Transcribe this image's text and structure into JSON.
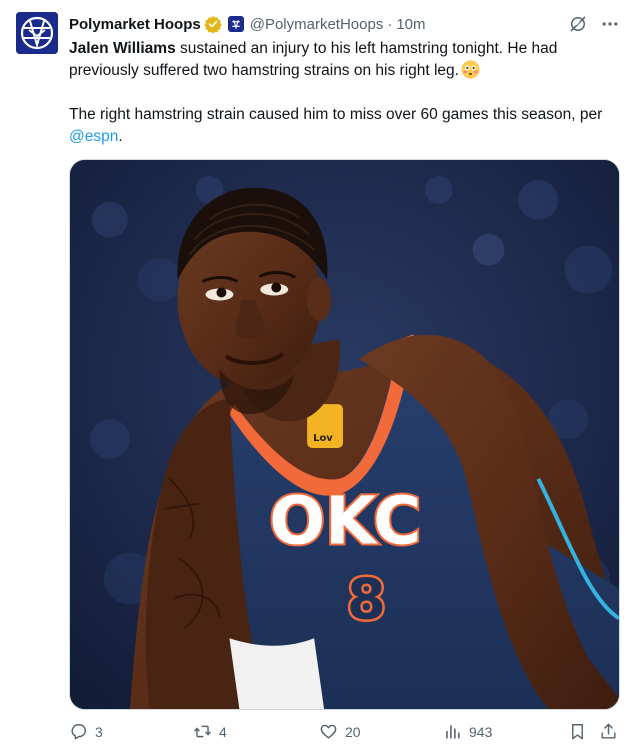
{
  "author": {
    "name": "Polymarket Hoops",
    "handle": "@PolymarketHoops",
    "separator": "·",
    "time": "10m"
  },
  "tweet": {
    "line1_bold": "Jalen Williams",
    "line1_rest": " sustained an injury to his left hamstring tonight. He had previously suffered two hamstring strains on his right leg.",
    "line2_pre": "The right hamstring strain caused him to miss over 60 games this season, per ",
    "mention": "@espn",
    "line2_post": ".",
    "emoji": "flushed-face-emoji"
  },
  "media": {
    "jersey_number": "8",
    "jersey_logo": "OKC",
    "patch_text": "Lov"
  },
  "actions": {
    "replies": "3",
    "reposts": "4",
    "likes": "20",
    "views": "943"
  },
  "colors": {
    "accent": "#1d9bf0",
    "muted": "#536471",
    "verified_gold": "#e2b719",
    "avatar_bg": "#1a2b8c"
  }
}
